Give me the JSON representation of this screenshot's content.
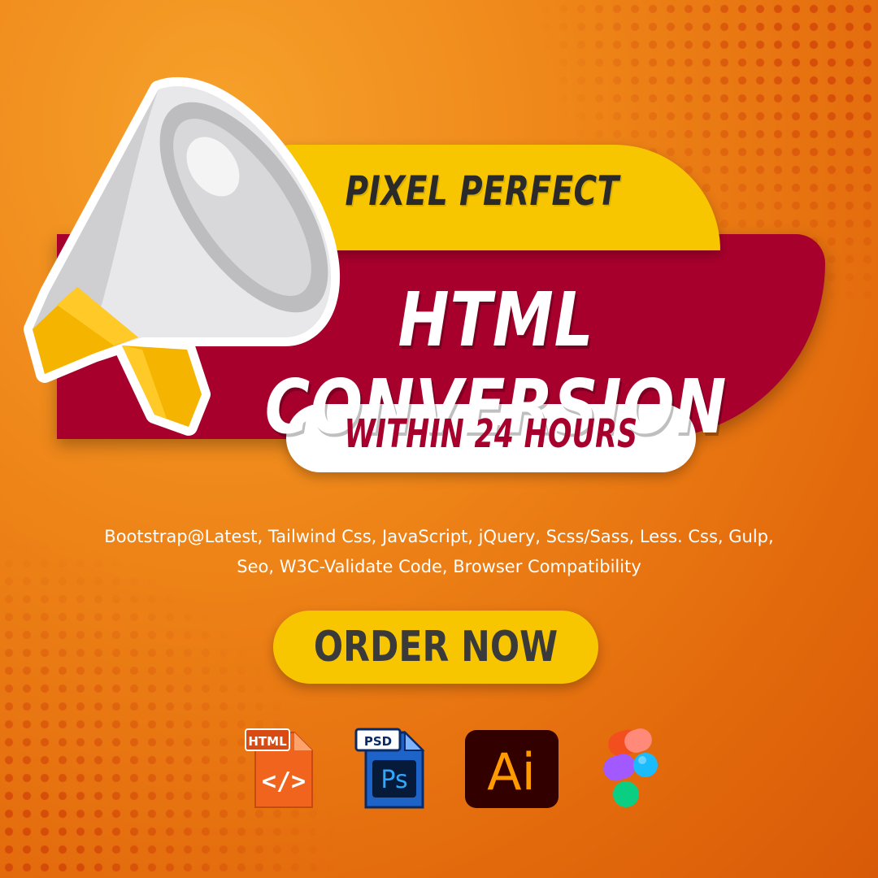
{
  "banner": {
    "tagline": "PIXEL PERFECT",
    "headline": "HTML CONVERSION",
    "subline": "WITHIN 24 HOURS"
  },
  "tech_line_1": "Bootstrap@Latest, Tailwind Css, JavaScript, jQuery, Scss/Sass, Less. Css, Gulp,",
  "tech_line_2": "Seo, W3C-Validate Code, Browser Compatibility",
  "cta": {
    "label": "ORDER NOW"
  },
  "icons": {
    "html": {
      "name": "html-file-icon",
      "badge": "HTML",
      "glyph": "</>"
    },
    "psd": {
      "name": "photoshop-file-icon",
      "badge": "PSD",
      "glyph": "Ps"
    },
    "ai": {
      "name": "illustrator-icon",
      "glyph": "Ai"
    },
    "figma": {
      "name": "figma-icon"
    }
  },
  "colors": {
    "background": "#ee8418",
    "yellow": "#f7c600",
    "crimson": "#a8002c",
    "dark_text": "#2a2a2a",
    "white": "#ffffff"
  }
}
